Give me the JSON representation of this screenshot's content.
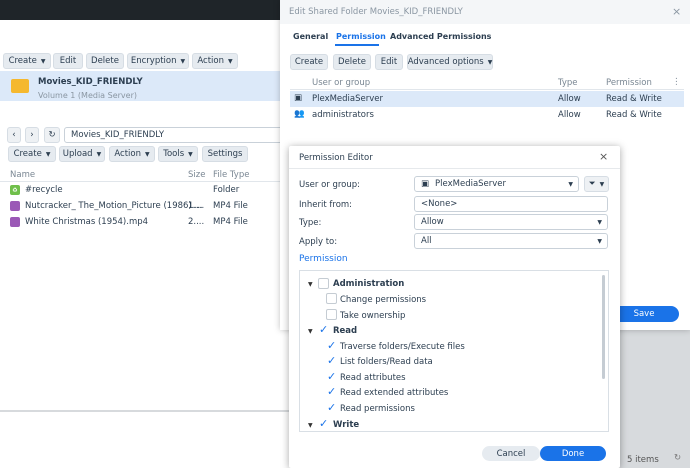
{
  "bg_window": {
    "toolbar": [
      "Create",
      "Edit",
      "Delete",
      "Encryption",
      "Action"
    ],
    "folder_name": "Movies_KID_FRIENDLY",
    "folder_sub": "Volume 1 (Media Server)"
  },
  "file_station": {
    "path": "Movies_KID_FRIENDLY",
    "toolbar": [
      "Create",
      "Upload",
      "Action",
      "Tools",
      "Settings"
    ],
    "columns": [
      "Name",
      "Size",
      "File Type"
    ],
    "rows": [
      {
        "name": "#recycle",
        "size": "",
        "type": "Folder"
      },
      {
        "name": "Nutcracker_ The_Motion_Picture (1986)....",
        "size": "1....",
        "type": "MP4 File"
      },
      {
        "name": "White Christmas (1954).mp4",
        "size": "2....",
        "type": "MP4 File"
      }
    ]
  },
  "shared_folder": {
    "title": "Edit Shared Folder Movies_KID_FRIENDLY",
    "tabs": [
      "General",
      "Permission",
      "Advanced Permissions"
    ],
    "toolbar": [
      "Create",
      "Delete",
      "Edit",
      "Advanced options"
    ],
    "columns": [
      "User or group",
      "Type",
      "Permission"
    ],
    "rows": [
      {
        "name": "PlexMediaServer",
        "type": "Allow",
        "perm": "Read & Write"
      },
      {
        "name": "administrators",
        "type": "Allow",
        "perm": "Read & Write"
      }
    ],
    "save_label": "Save"
  },
  "editor": {
    "title": "Permission Editor",
    "user_label": "User or group:",
    "user_value": "PlexMediaServer",
    "inherit_label": "Inherit from:",
    "inherit_value": "<None>",
    "type_label": "Type:",
    "type_value": "Allow",
    "apply_label": "Apply to:",
    "apply_value": "All",
    "section": "Permission",
    "tree": {
      "admin": "Administration",
      "change": "Change permissions",
      "owner": "Take ownership",
      "read": "Read",
      "traverse": "Traverse folders/Execute files",
      "list": "List folders/Read data",
      "attrs": "Read attributes",
      "ext": "Read extended attributes",
      "perms": "Read permissions",
      "write": "Write"
    },
    "cancel": "Cancel",
    "done": "Done"
  },
  "status": {
    "items": "5 items"
  },
  "colors": {
    "accent": "#1a73e8",
    "selected": "#dce9f9"
  }
}
